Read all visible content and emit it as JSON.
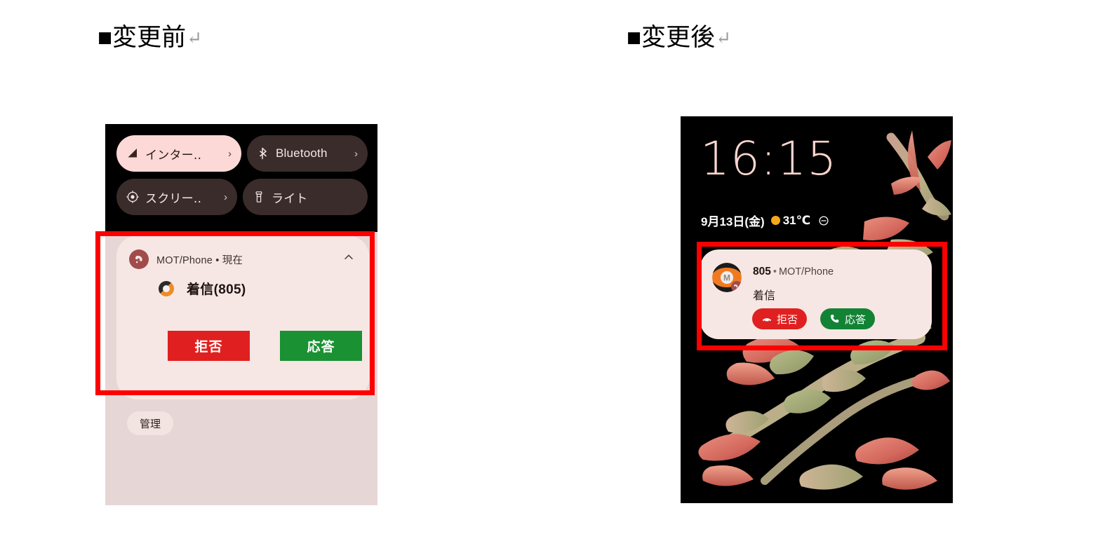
{
  "headings": {
    "before": "■変更前",
    "after": "■変更後",
    "pilcrow": "↵"
  },
  "left_phone": {
    "quick_settings": [
      {
        "label": "インター‥",
        "icon": "signal-triangle-icon",
        "chevron": "›",
        "active": true
      },
      {
        "label": "Bluetooth",
        "icon": "bluetooth-icon",
        "chevron": "›",
        "active": false
      },
      {
        "label": "スクリー‥",
        "icon": "screen-record-icon",
        "chevron": "›",
        "active": false
      },
      {
        "label": "ライト",
        "icon": "flashlight-icon",
        "chevron": "",
        "active": false
      }
    ],
    "notification": {
      "app_name": "MOT/Phone",
      "separator": "•",
      "time": "現在",
      "app_text": "MOT/Phone • 現在",
      "collapse_icon": "chevron-up-icon",
      "app_icon": "mot-phone-app-icon",
      "caller_avatar": "caller-avatar-icon",
      "title": "着信(805)",
      "reject_label": "拒否",
      "answer_label": "応答",
      "reject_color": "#e02020",
      "answer_color": "#1a9133"
    },
    "manage_label": "管理",
    "background_color": "#e6d7d6",
    "shade_color": "#000000"
  },
  "right_phone": {
    "lock_screen": {
      "time": "16:15",
      "date": "9月13日(金)",
      "weather_icon": "sun-icon",
      "temperature": "31℃",
      "dnd_icon": "do-not-disturb-icon",
      "wallpaper": "succulent-flower-wallpaper"
    },
    "notification": {
      "caller_number": "805",
      "separator": "•",
      "app_name": "MOT/Phone",
      "body": "着信",
      "avatar": "mot-phone-caller-avatar",
      "reject_label": "拒否",
      "reject_icon": "phone-hangup-icon",
      "answer_label": "応答",
      "answer_icon": "phone-icon",
      "reject_color": "#e02020",
      "answer_color": "#128335"
    }
  },
  "annotations": {
    "highlight_color": "#ff0000",
    "highlight_left_label": "highlight-box-before",
    "highlight_right_label": "highlight-box-after"
  }
}
